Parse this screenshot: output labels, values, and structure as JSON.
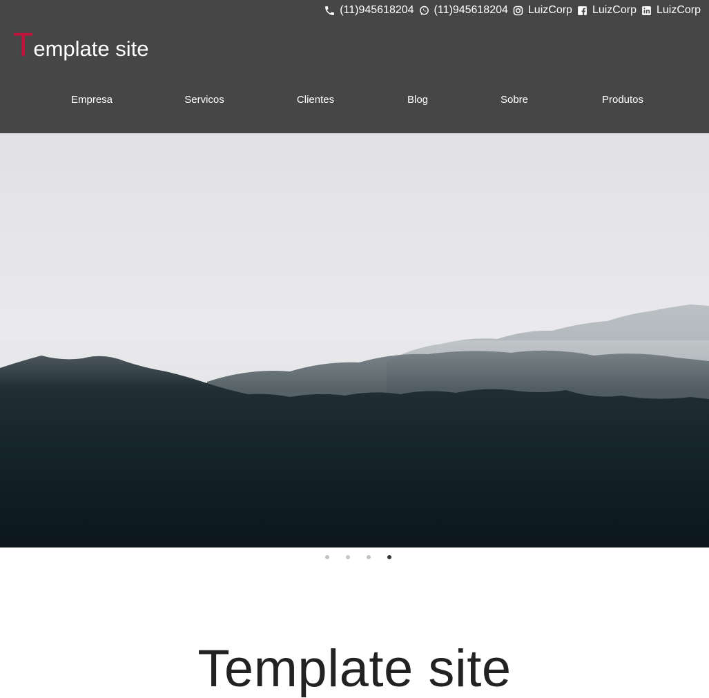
{
  "contacts": {
    "phone": "(11)945618204",
    "whatsapp": "(11)945618204",
    "instagram": "LuizCorp",
    "facebook": "LuizCorp",
    "linkedin": "LuizCorp"
  },
  "logo": {
    "first_letter": "T",
    "rest": "emplate site"
  },
  "nav": {
    "items": [
      "Empresa",
      "Servicos",
      "Clientes",
      "Blog",
      "Sobre",
      "Produtos"
    ]
  },
  "carousel": {
    "slide_count": 4,
    "active_index": 3
  },
  "main": {
    "title": "Template site"
  },
  "colors": {
    "header_bg": "#464646",
    "accent": "#c0143c",
    "text_light": "#ffffff"
  }
}
